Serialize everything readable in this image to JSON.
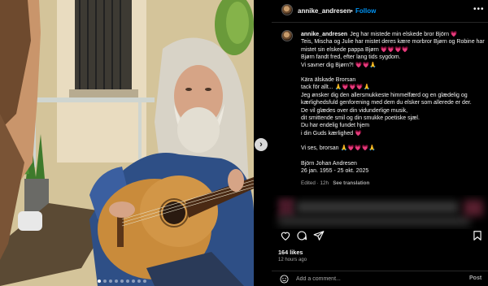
{
  "post": {
    "username": "annike_andresen",
    "follow_label": "Follow",
    "header_separator": "•",
    "more_label": "•••",
    "caption_lines": [
      "Jeg har mistede min elskede bror Björn 💗",
      "Teis, Mischa og Julie har mistet deres kære morbror Bjørn og Robine har mistet sin elskede pappa Bjørn 💗💗💗💗",
      "Bjørn fandt fred, efter lang tids sygdom.",
      "Vi savner dig Bjørn?! 💗💗🙏"
    ],
    "letter_lines": [
      "Kära älskade Brorsan",
      "tack för allt... 🙏💗💗💗🙏",
      "Jeg ønsker dig den allersmukkeste himmelfærd og en glædelig og kærlighedsfuld genforening med dem du elsker som allerede er der.",
      "De vil glædes over din vidunderlige musik,",
      "dit smittende smil og din smukke poetiske sjæl.",
      "Du har endelig fundet hjem",
      "i din Guds kærlighed 💗"
    ],
    "farewell": "Vi ses, brorsan 🙏💗💗💗🙏",
    "signature_lines": [
      "Björn Johan Andresen",
      "26 jan. 1955 - 25 okt. 2025"
    ],
    "meta_edited": "Edited · 12h",
    "meta_translation": "See translation",
    "likes": "164 likes",
    "time_ago": "12 hours ago",
    "comment_placeholder": "Add a comment...",
    "post_label": "Post",
    "next_label": "›",
    "carousel_count": 9,
    "carousel_active": 0
  },
  "colors": {
    "background": "#000000",
    "follow_blue": "#0095f6",
    "muted": "#a8a8a8",
    "heart_pink": "#ff4f8b"
  },
  "icons": [
    "heart-icon",
    "comment-icon",
    "share-icon",
    "bookmark-icon",
    "emoji-icon",
    "avatar-icon",
    "more-icon",
    "chevron-right-icon"
  ]
}
